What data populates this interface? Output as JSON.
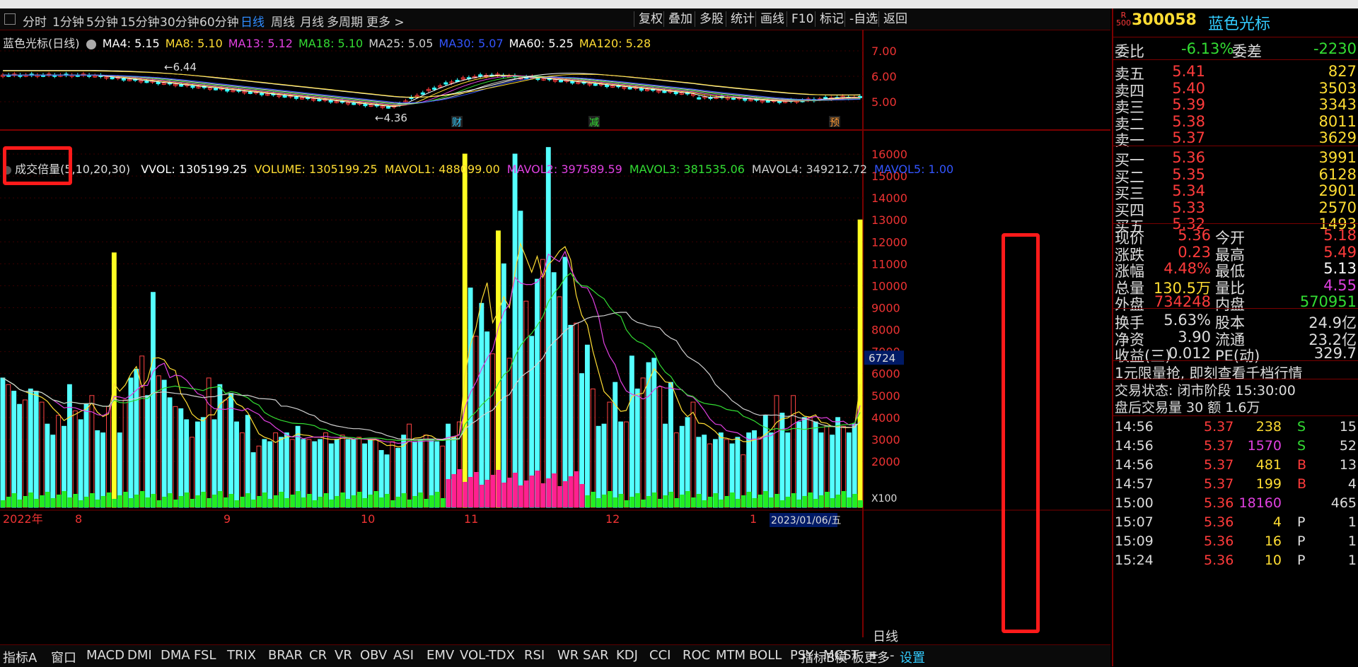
{
  "period_bar": {
    "tabs": [
      "分时",
      "1分钟",
      "5分钟",
      "15分钟",
      "30分钟",
      "60分钟",
      "日线",
      "周线",
      "月线",
      "多周期",
      "更多 >"
    ],
    "active_tab": "日线",
    "right_buttons": [
      "复权",
      "叠加",
      "多股",
      "统计",
      "画线",
      "F10",
      "标记",
      "-自选",
      "返回"
    ]
  },
  "price_chart": {
    "title": "蓝色光标(日线)",
    "ma_labels": [
      {
        "text": "MA4: 5.15",
        "color": "#ffffff"
      },
      {
        "text": "MA8: 5.10",
        "color": "#ffdd33"
      },
      {
        "text": "MA13: 5.12",
        "color": "#e040e0"
      },
      {
        "text": "MA18: 5.10",
        "color": "#33dd33"
      },
      {
        "text": "MA25: 5.05",
        "color": "#d0d0d0"
      },
      {
        "text": "MA30: 5.07",
        "color": "#3355ff"
      },
      {
        "text": "MA60: 5.25",
        "color": "#ffffff"
      },
      {
        "text": "MA120: 5.28",
        "color": "#ffdd33"
      }
    ],
    "y_ticks": [
      "7.00",
      "6.00",
      "5.00"
    ],
    "annotations": {
      "high": "6.44",
      "low": "4.36"
    },
    "event_markers": [
      "财",
      "减",
      "预"
    ]
  },
  "volume_chart": {
    "indicator_name": "成交倍量",
    "params": "(5,10,20,30)",
    "legend": [
      {
        "text": "VVOL: 1305199.25",
        "color": "#ffffff"
      },
      {
        "text": "VOLUME: 1305199.25",
        "color": "#ffdd33"
      },
      {
        "text": "MAVOL1: 488099.00",
        "color": "#ffdd33"
      },
      {
        "text": "MAVOL2: 397589.59",
        "color": "#e040e0"
      },
      {
        "text": "MAVOL3: 381535.06",
        "color": "#33dd33"
      },
      {
        "text": "MAVOL4: 349212.72",
        "color": "#d0d0d0"
      },
      {
        "text": "MAVOL5: 1.00",
        "color": "#3355ff"
      }
    ],
    "y_ticks": [
      "16000",
      "15000",
      "14000",
      "13000",
      "12000",
      "11000",
      "10000",
      "9000",
      "8000",
      "7000",
      "6000",
      "5000",
      "4000",
      "3000",
      "2000"
    ],
    "current_value_tag": "6724",
    "scale_tag": "X100",
    "x_labels": [
      "2022年",
      "8",
      "9",
      "10",
      "11",
      "12",
      "1"
    ],
    "date_tag": "2023/01/06/五"
  },
  "chart_data": {
    "type": "bar",
    "title": "",
    "xlabel": "",
    "ylabel": "",
    "ylim": [
      0,
      16500
    ],
    "note_unit": "X100",
    "series": [
      {
        "values": [
          5800,
          5500,
          5200,
          4600,
          4800,
          5300,
          5200,
          4700,
          3700,
          3200,
          4100,
          3600,
          5500,
          4300,
          3900,
          4600,
          5000,
          3400,
          3300,
          4500,
          11500,
          3300,
          4800,
          5800,
          6200,
          6800,
          5000,
          9700,
          5900,
          5700,
          4900,
          4500,
          4400,
          3900,
          3100,
          3800,
          4000,
          5800,
          3900,
          5500,
          4800,
          5100,
          3800,
          3300,
          4100,
          2400,
          2700,
          3000,
          2900,
          3300,
          3100,
          3300,
          3000,
          3600,
          3000,
          3000,
          2900,
          3000,
          3300,
          2800,
          3000,
          3200,
          3000,
          3000,
          3100,
          2800,
          3000,
          3000,
          2500,
          2300,
          2900,
          2600,
          3200,
          3700,
          2900,
          3000,
          3200,
          3000,
          2900,
          2700,
          3700,
          3100,
          3800,
          16000,
          9900,
          7700,
          9200,
          7900,
          6900,
          12500,
          11000,
          6700,
          16000,
          13400,
          9300,
          7700,
          10300,
          11200,
          16300,
          10600,
          9500,
          11300,
          8200,
          8300,
          6000,
          7300,
          5300,
          3600,
          3700,
          4700,
          5600,
          3800,
          3800,
          6800,
          5300,
          5800,
          6500,
          6700,
          5400,
          3700,
          5600,
          3300,
          3600,
          4000,
          4700,
          3100,
          3200,
          2800,
          3000,
          3300,
          3000,
          2800,
          3100,
          2300,
          3300,
          3400,
          3100,
          4100,
          3300,
          5000,
          4200,
          3300,
          5000,
          3800,
          4000,
          4000,
          3800,
          3300,
          3600,
          3200,
          4000,
          3600,
          3300,
          3700,
          13000
        ]
      }
    ]
  },
  "bottom_tabs": [
    "指标A",
    "窗口",
    "MACD",
    "DMI",
    "DMA",
    "FSL",
    "TRIX",
    "BRAR",
    "CR",
    "VR",
    "OBV",
    "ASI",
    "EMV",
    "VOL-TDX",
    "RSI",
    "WR",
    "SAR",
    "KDJ",
    "CCI",
    "ROC",
    "MTM",
    "BOLL",
    "PSY",
    "MCST",
    "更多",
    "设置"
  ],
  "bottom_right_tabs": [
    "指标B",
    "模 板",
    "+",
    "-"
  ],
  "bottom_right_label": "日线",
  "stock": {
    "badge": "R",
    "badge_sub": "500",
    "code": "300058",
    "name": "蓝色光标"
  },
  "order_book": {
    "wei_bi_label": "委比",
    "wei_bi": "-6.13%",
    "wei_cha_label": "委差",
    "wei_cha": "-2230",
    "asks": [
      {
        "label": "卖五",
        "price": "5.41",
        "vol": "827"
      },
      {
        "label": "卖四",
        "price": "5.40",
        "vol": "3503"
      },
      {
        "label": "卖三",
        "price": "5.39",
        "vol": "3343"
      },
      {
        "label": "卖二",
        "price": "5.38",
        "vol": "8011"
      },
      {
        "label": "卖一",
        "price": "5.37",
        "vol": "3629"
      }
    ],
    "bids": [
      {
        "label": "买一",
        "price": "5.36",
        "vol": "3991"
      },
      {
        "label": "买二",
        "price": "5.35",
        "vol": "6128"
      },
      {
        "label": "买三",
        "price": "5.34",
        "vol": "2901"
      },
      {
        "label": "买四",
        "price": "5.33",
        "vol": "2570"
      },
      {
        "label": "买五",
        "price": "5.32",
        "vol": "1493"
      }
    ]
  },
  "quote_stats": [
    {
      "l1": "现价",
      "v1": "5.36",
      "c1": "#ff3b3b",
      "l2": "今开",
      "v2": "5.18",
      "c2": "#ff3b3b"
    },
    {
      "l1": "涨跌",
      "v1": "0.23",
      "c1": "#ff3b3b",
      "l2": "最高",
      "v2": "5.49",
      "c2": "#ff3b3b"
    },
    {
      "l1": "涨幅",
      "v1": "4.48%",
      "c1": "#ff3b3b",
      "l2": "最低",
      "v2": "5.13",
      "c2": "#ffffff"
    },
    {
      "l1": "总量",
      "v1": "130.5万",
      "c1": "#ffdd33",
      "l2": "量比",
      "v2": "4.55",
      "c2": "#e040e0"
    },
    {
      "l1": "外盘",
      "v1": "734248",
      "c1": "#ff3b3b",
      "l2": "内盘",
      "v2": "570951",
      "c2": "#33dd33"
    }
  ],
  "fundamentals": [
    {
      "l1": "换手",
      "v1": "5.63%",
      "l2": "股本",
      "v2": "24.9亿"
    },
    {
      "l1": "净资",
      "v1": "3.90",
      "l2": "流通",
      "v2": "23.2亿"
    },
    {
      "l1": "收益(三)",
      "v1": "0.012",
      "l2": "PE(动)",
      "v2": "329.7"
    }
  ],
  "promo": "1元限量抢, 即刻查看千档行情",
  "trade_status": "交易状态: 闭市阶段 15:30:00",
  "after_hours": "盘后交易量 30 额 1.6万",
  "ticks": [
    {
      "time": "14:56",
      "price": "5.37",
      "vol": "238",
      "vc": "#ffdd33",
      "flag": "S",
      "fc": "#33dd33",
      "n": "15"
    },
    {
      "time": "14:56",
      "price": "5.37",
      "vol": "1570",
      "vc": "#e040e0",
      "flag": "S",
      "fc": "#33dd33",
      "n": "52"
    },
    {
      "time": "14:56",
      "price": "5.37",
      "vol": "481",
      "vc": "#ffdd33",
      "flag": "B",
      "fc": "#ff3b3b",
      "n": "13"
    },
    {
      "time": "14:57",
      "price": "5.37",
      "vol": "199",
      "vc": "#ffdd33",
      "flag": "B",
      "fc": "#ff3b3b",
      "n": "4"
    },
    {
      "time": "15:00",
      "price": "5.36",
      "vol": "18160",
      "vc": "#e040e0",
      "flag": "",
      "fc": "#ddd",
      "n": "465"
    },
    {
      "time": "15:07",
      "price": "5.36",
      "vol": "4",
      "vc": "#ffdd33",
      "flag": "P",
      "fc": "#ddd",
      "n": "1"
    },
    {
      "time": "15:09",
      "price": "5.36",
      "vol": "16",
      "vc": "#ffdd33",
      "flag": "P",
      "fc": "#ddd",
      "n": "1"
    },
    {
      "time": "15:24",
      "price": "5.36",
      "vol": "10",
      "vc": "#ffdd33",
      "flag": "P",
      "fc": "#ddd",
      "n": "1"
    }
  ]
}
